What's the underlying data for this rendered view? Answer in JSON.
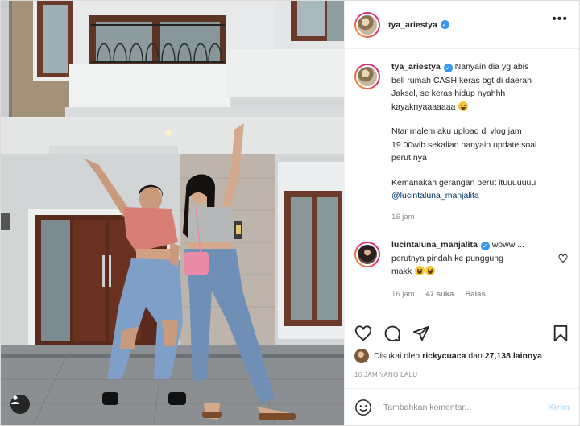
{
  "post": {
    "username": "tya_ariestya",
    "verified": true,
    "more_icon": "more-horizontal-icon"
  },
  "caption": {
    "username": "tya_ariestya",
    "lines_1": [
      "Nanyain dia yg abis",
      "beli rumah CASH keras bgt di daerah",
      "Jaksel, se keras hidup nyahhh",
      "kayaknyaaaaaaa"
    ],
    "lines_2": [
      "Ntar malem aku upload di vlog jam",
      "19.00wib sekalian nanyain update soal",
      "perut nya"
    ],
    "lines_3": [
      "Kemanakah gerangan perut ituuuuuuu"
    ],
    "mention": "@lucintaluna_manjalita",
    "time": "16 jam"
  },
  "comment": {
    "username": "lucintaluna_manjalita",
    "text_1": "woww ...",
    "text_2": "perutnya pindah ke punggung",
    "text_3": "makk",
    "time": "16 jam",
    "likes": "47 suka",
    "reply": "Balas"
  },
  "actions": {
    "icons": [
      "heart-icon",
      "comment-icon",
      "share-icon",
      "bookmark-icon"
    ]
  },
  "likes": {
    "prefix": "Disukai oleh",
    "user": "rickycuaca",
    "mid": "dan",
    "count": "27,138 lainnya"
  },
  "date": "16 JAM YANG LALU",
  "add_comment": {
    "placeholder": "Tambahkan komentar...",
    "post_label": "Kirim"
  },
  "colors": {
    "link": "#00376b",
    "verified": "#3897f0",
    "muted": "#8e8e8e",
    "post_button": "#b2dffc"
  }
}
